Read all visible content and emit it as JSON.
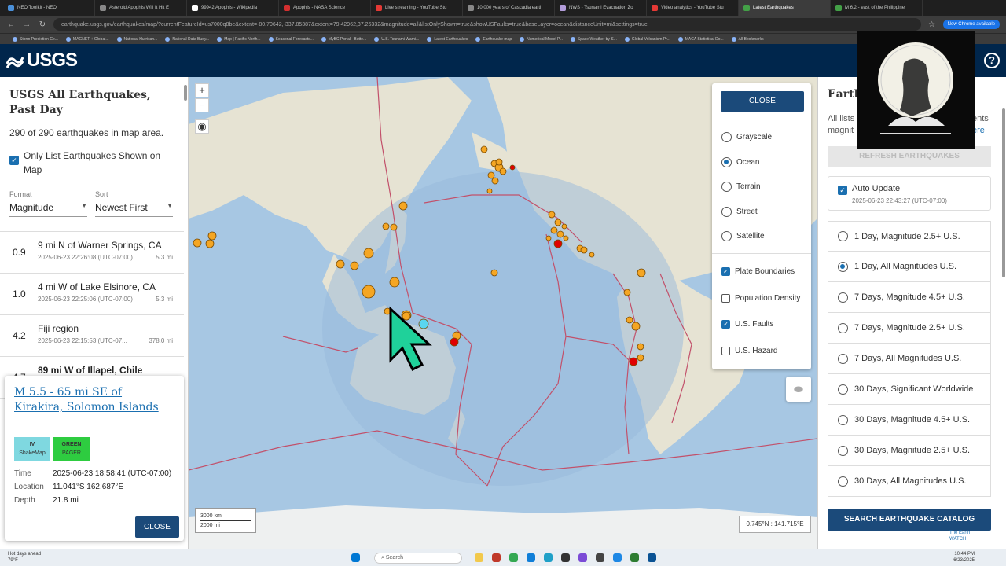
{
  "browser": {
    "tabs": [
      {
        "label": "NEO Toolkit - NEO",
        "color": "#4a90d9"
      },
      {
        "label": "Asteroid Apophis Will It Hit E",
        "color": "#888888"
      },
      {
        "label": "99942 Apophis - Wikipedia",
        "color": "#ffffff"
      },
      {
        "label": "Apophis - NASA Science",
        "color": "#d32f2f"
      },
      {
        "label": "Live streaming - YouTube Stu",
        "color": "#e53935"
      },
      {
        "label": "10,000 years of Cascadia earti",
        "color": "#888888"
      },
      {
        "label": "NWS - Tsunami Evacuation Zo",
        "color": "#b39ddb"
      },
      {
        "label": "Video analytics - YouTube Stu",
        "color": "#e53935"
      },
      {
        "label": "Latest Earthquakes",
        "color": "#43a047",
        "active": true
      },
      {
        "label": "M 6.2 - east of the Philippine",
        "color": "#43a047"
      }
    ],
    "url": "earthquake.usgs.gov/earthquakes/map/?currentFeatureId=us7000q8be&extent=-80.70642,-337.85387&extent=79.42962,37.26332&magnitude=all&listOnlyShown=true&showUSFaults=true&baseLayer=ocean&distanceUnit=mi&settings=true",
    "new_chrome_label": "New Chrome available",
    "bookmarks": [
      "Storm Prediction Ce...",
      "MAGNET + Global...",
      "National Hurrican...",
      "National Data Buoy...",
      "Map | Pacific North...",
      "Seasonal Forecasts...",
      "MyBC Portal - Butte...",
      "U.S. Tsunami Warni...",
      "Latest Earthquakes",
      "Earthquake map",
      "Numerical Model P...",
      "Space Weather by S...",
      "Global Volcanism Pr...",
      "MACA Statistical Do...",
      "All Bookmarks"
    ]
  },
  "header": {
    "logo": "USGS",
    "help_icon": "question-icon"
  },
  "list_panel": {
    "title": "USGS All Earthquakes, Past Day",
    "count": "290 of 290 earthquakes in map area.",
    "only_shown_label": "Only List Earthquakes Shown on Map",
    "format_label": "Format",
    "format_value": "Magnitude",
    "sort_label": "Sort",
    "sort_value": "Newest First",
    "earthquakes": [
      {
        "mag": "0.9",
        "place": "9 mi N of Warner Springs, CA",
        "time": "2025-06-23 22:26:08 (UTC-07:00)",
        "depth": "5.3 mi"
      },
      {
        "mag": "1.0",
        "place": "4 mi W of Lake Elsinore, CA",
        "time": "2025-06-23 22:25:06 (UTC-07:00)",
        "depth": "5.3 mi"
      },
      {
        "mag": "4.2",
        "place": "Fiji region",
        "time": "2025-06-23 22:15:53 (UTC-07...",
        "depth": "378.0 mi"
      },
      {
        "mag": "4.7",
        "place": "89 mi W of Illapel, Chile",
        "time": "",
        "depth": ""
      }
    ]
  },
  "popup": {
    "title": "M 5.5 - 65 mi SE of Kirakira, Solomon Islands",
    "shakemap_value": "IV",
    "shakemap_label": "ShakeMap",
    "pager_value": "GREEN",
    "pager_label": "PAGER",
    "time_label": "Time",
    "time_value": "2025-06-23 18:58:41 (UTC-07:00)",
    "location_label": "Location",
    "location_value": "11.041°S 162.687°E",
    "depth_label": "Depth",
    "depth_value": "21.8 mi",
    "close_label": "CLOSE"
  },
  "map": {
    "zoom_in": "+",
    "zoom_out": "−",
    "scale_km": "3000 km",
    "scale_mi": "2000 mi",
    "coords": "0.745°N : 141.715°E",
    "layers": {
      "close_label": "CLOSE",
      "basemaps": [
        {
          "label": "Grayscale",
          "selected": false
        },
        {
          "label": "Ocean",
          "selected": true
        },
        {
          "label": "Terrain",
          "selected": false
        },
        {
          "label": "Street",
          "selected": false
        },
        {
          "label": "Satellite",
          "selected": false
        }
      ],
      "overlays": [
        {
          "label": "Plate Boundaries",
          "checked": true
        },
        {
          "label": "Population Density",
          "checked": false
        },
        {
          "label": "U.S. Faults",
          "checked": true
        },
        {
          "label": "U.S. Hazard",
          "checked": false
        }
      ]
    },
    "colors": {
      "ocean": "#a7c7e3",
      "land": "#e7e4d6",
      "quake_old": "#f5a623",
      "quake_new": "#e00000",
      "quake_recent": "#5ad6f0",
      "plate": "#c2506a"
    }
  },
  "settings_panel": {
    "title": "Earth",
    "text_line1": "All lists",
    "text_line1_tail": "ents",
    "text_line2": "magnit",
    "text_link": "ere",
    "refresh_label": "REFRESH EARTHQUAKES",
    "auto_update_label": "Auto Update",
    "auto_update_time": "2025-06-23 22:43:27 (UTC-07:00)",
    "feeds": [
      {
        "label": "1 Day, Magnitude 2.5+ U.S.",
        "selected": false
      },
      {
        "label": "1 Day, All Magnitudes U.S.",
        "selected": true
      },
      {
        "label": "7 Days, Magnitude 4.5+ U.S.",
        "selected": false
      },
      {
        "label": "7 Days, Magnitude 2.5+ U.S.",
        "selected": false
      },
      {
        "label": "7 Days, All Magnitudes U.S.",
        "selected": false
      },
      {
        "label": "30 Days, Significant Worldwide",
        "selected": false
      },
      {
        "label": "30 Days, Magnitude 4.5+ U.S.",
        "selected": false
      },
      {
        "label": "30 Days, Magnitude 2.5+ U.S.",
        "selected": false
      },
      {
        "label": "30 Days, All Magnitudes U.S.",
        "selected": false
      }
    ],
    "search_label": "SEARCH EARTHQUAKE CATALOG"
  },
  "taskbar": {
    "weather_line1": "Hot days ahead",
    "weather_line2": "79°F",
    "search_placeholder": "Search",
    "time": "10:44 PM",
    "date": "6/23/2025",
    "watermark_line1": "The Earth",
    "watermark_line2": "WATCH"
  }
}
